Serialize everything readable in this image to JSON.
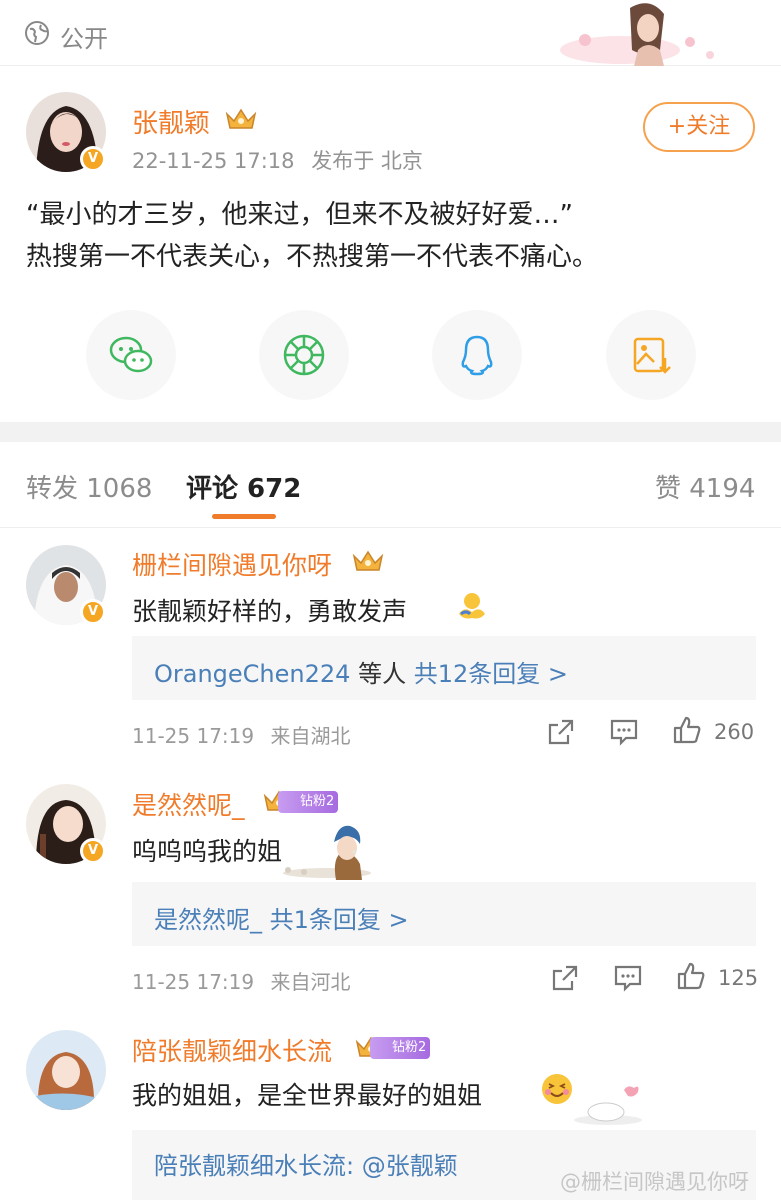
{
  "header": {
    "visibility_label": "公开",
    "globe_icon": "globe-icon"
  },
  "post": {
    "author": "张靓颖",
    "time": "22-11-25 17:18",
    "location": "发布于 北京",
    "follow_label": "+关注",
    "verified": "V",
    "text_line1": "“最小的才三岁，他来过，但来不及被好好爱…”",
    "text_line2": "热搜第一不代表关心，不热搜第一不代表不痛心。",
    "share_icons": [
      "wechat-icon",
      "moments-icon",
      "qq-icon",
      "save-image-icon"
    ],
    "colors": {
      "accent": "#f07c2b",
      "link": "#4a7fb8",
      "wechat": "#3fb860",
      "qq": "#2f9ee6"
    }
  },
  "tabs": {
    "repost": "转发 1068",
    "comment": "评论 672",
    "like": "赞 4194"
  },
  "comments": [
    {
      "name": "栅栏间隙遇见你呀",
      "text": "张靓颖好样的，勇敢发声",
      "reply_users": "OrangeChen224",
      "reply_mid": " 等人 ",
      "reply_count": "共12条回复 >",
      "time": "11-25 17:19",
      "location": "来自湖北",
      "likes": "260"
    },
    {
      "name": "是然然呢_",
      "badge": "钻粉2",
      "text": "呜呜呜我的姐",
      "reply_users": "是然然呢_",
      "reply_mid": " ",
      "reply_count": "共1条回复 >",
      "time": "11-25 17:19",
      "location": "来自河北",
      "likes": "125"
    },
    {
      "name": "陪张靓颖细水长流",
      "badge": "钻粉2",
      "text": "我的姐姐，是全世界最好的姐姐",
      "reply_users": "陪张靓颖细水长流:",
      "reply_mention": " @张靓颖"
    }
  ],
  "watermark": "@栅栏间隙遇见你呀"
}
